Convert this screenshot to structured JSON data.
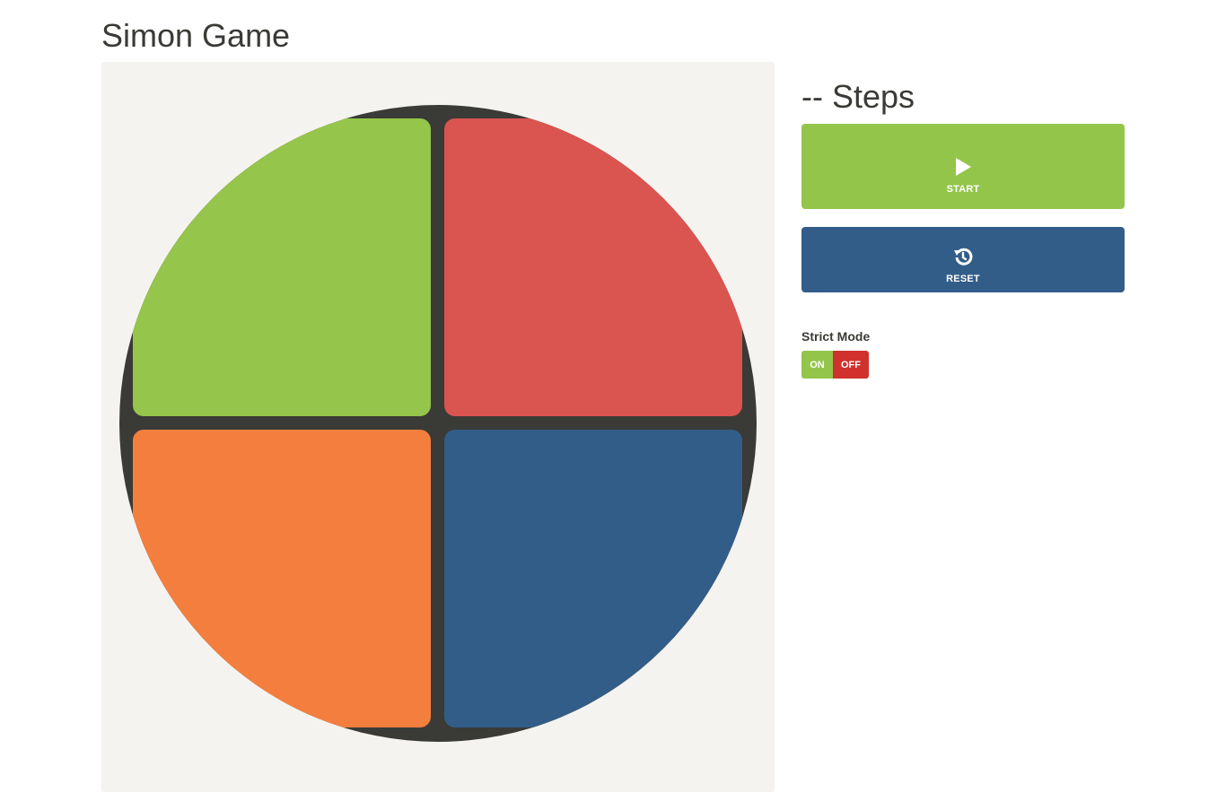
{
  "page": {
    "title": "Simon Game"
  },
  "game": {
    "pads": [
      {
        "name": "green",
        "color": "#95c54b"
      },
      {
        "name": "red",
        "color": "#da5450"
      },
      {
        "name": "orange",
        "color": "#f47e3e"
      },
      {
        "name": "blue",
        "color": "#325d88"
      }
    ],
    "ring_color": "#3a3a36",
    "board_background": "#f5f3ef"
  },
  "controls": {
    "steps_display": "-- Steps",
    "start": {
      "label": "START",
      "icon": "play-icon",
      "color": "#93c54b"
    },
    "reset": {
      "label": "RESET",
      "icon": "reset-history-icon",
      "color": "#325d88"
    },
    "strict_mode": {
      "label": "Strict Mode",
      "on_label": "ON",
      "off_label": "OFF",
      "on_color": "#93c54b",
      "off_color": "#d0312d"
    }
  }
}
